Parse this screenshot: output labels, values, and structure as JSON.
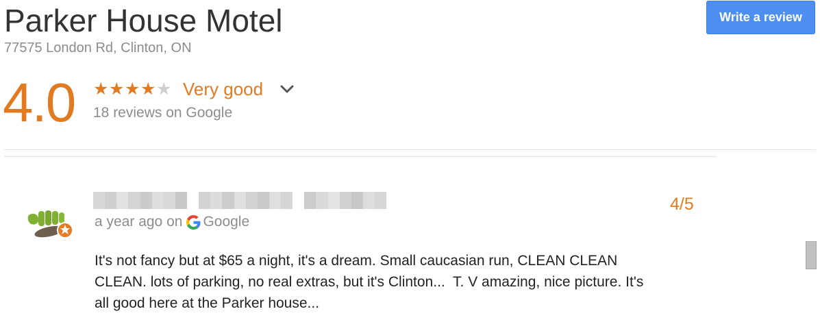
{
  "business": {
    "name": "Parker House Motel",
    "address": "77575 London Rd, Clinton, ON"
  },
  "actions": {
    "write_review_label": "Write a review"
  },
  "summary": {
    "rating": "4.0",
    "stars_filled": 4,
    "stars_total": 5,
    "star_glyph": "★",
    "rating_label": "Very good",
    "review_count_text": "18 reviews on Google"
  },
  "review": {
    "time_text": "a year ago on",
    "source_text": "Google",
    "score": "4/5",
    "body": "It's not fancy but at $65 a night, it's a dream. Small caucasian run, CLEAN CLEAN\nCLEAN. lots of parking, no real extras, but it's Clinton...  T. V amazing, nice picture. It's\nall good here at the Parker house..."
  },
  "colors": {
    "accent": "#e07b22",
    "button_blue": "#4d8ff0",
    "muted_text": "#8c8c8c"
  }
}
